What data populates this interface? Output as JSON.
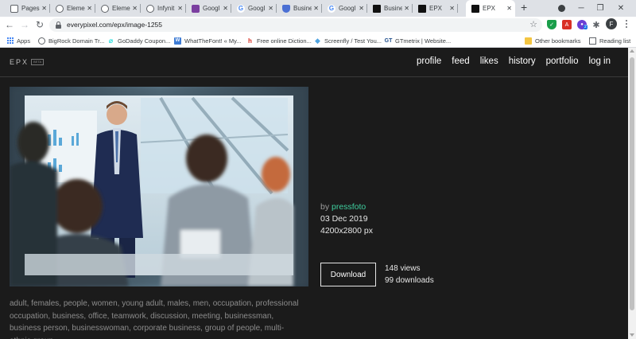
{
  "browser": {
    "tabs": [
      {
        "label": "Pages",
        "icon": "document-icon"
      },
      {
        "label": "Eleme",
        "icon": "globe-icon"
      },
      {
        "label": "Eleme",
        "icon": "globe-icon"
      },
      {
        "label": "Infynit",
        "icon": "globe-icon"
      },
      {
        "label": "Googl",
        "icon": "purple-app-icon"
      },
      {
        "label": "Googl",
        "icon": "google-icon"
      },
      {
        "label": "Busine",
        "icon": "shield-icon"
      },
      {
        "label": "Googl",
        "icon": "google-icon"
      },
      {
        "label": "Busine",
        "icon": "epx-icon"
      },
      {
        "label": "EPX",
        "icon": "epx-icon"
      },
      {
        "label": "EPX",
        "icon": "epx-icon",
        "active": true
      }
    ],
    "new_tab": "+",
    "url": "everypixel.com/epx/image-1255",
    "avatar_letter": "F",
    "ext_badge": "2",
    "bookmarks": [
      {
        "label": "Apps",
        "icon": "apps-icon"
      },
      {
        "label": "BigRock Domain Tr...",
        "icon": "globe-icon"
      },
      {
        "label": "GoDaddy Coupon...",
        "icon": "godaddy-icon"
      },
      {
        "label": "WhatTheFont! « My...",
        "icon": "whatthefont-icon"
      },
      {
        "label": "Free online Diction...",
        "icon": "hj-icon"
      },
      {
        "label": "Screenfly / Test You...",
        "icon": "screenfly-icon"
      },
      {
        "label": "GTmetrix | Website...",
        "icon": "gtmetrix-icon"
      }
    ],
    "other_bookmarks": "Other bookmarks",
    "reading_list": "Reading list"
  },
  "site": {
    "logo": "EPX",
    "logo_tag": "BETA",
    "nav": [
      "profile",
      "feed",
      "likes",
      "history",
      "portfolio",
      "log in"
    ]
  },
  "image_info": {
    "by_label": "by",
    "author": "pressfoto",
    "date": "03 Dec 2019",
    "resolution": "4200x2800 px",
    "download_label": "Download",
    "views": "148 views",
    "downloads": "99 downloads"
  },
  "tags": "adult, females, people, women, young adult, males, men, occupation, professional occupation, business, office, teamwork, discussion, meeting, businessman, business person, businesswoman, corporate business, group of people, multi-ethnic group"
}
